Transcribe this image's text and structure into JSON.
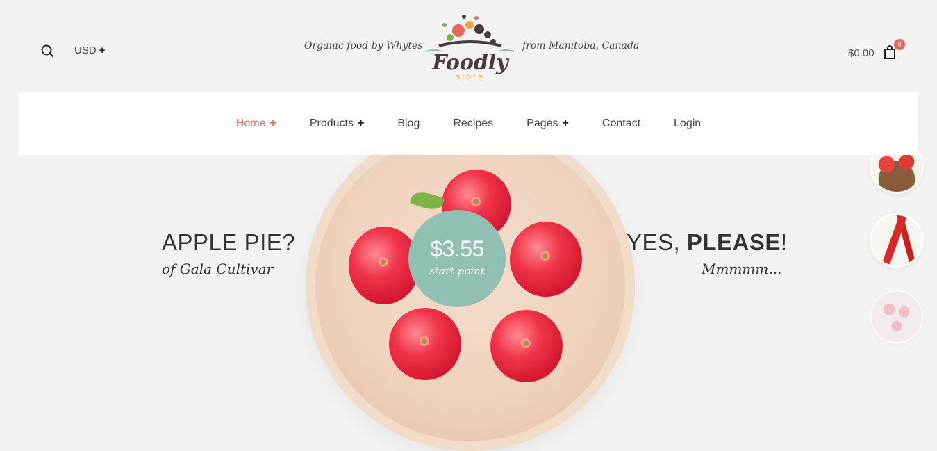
{
  "header": {
    "currency": "USD",
    "tagline_left": "Organic food by Whytes'",
    "tagline_right": "from Manitoba, Canada",
    "logo_text": "Foodly",
    "logo_sub": "store",
    "cart_total": "$0.00",
    "cart_count": "0"
  },
  "nav": {
    "items": [
      {
        "label": "Home",
        "has_submenu": true
      },
      {
        "label": "Products",
        "has_submenu": true
      },
      {
        "label": "Blog",
        "has_submenu": false
      },
      {
        "label": "Recipes",
        "has_submenu": false
      },
      {
        "label": "Pages",
        "has_submenu": true
      },
      {
        "label": "Contact",
        "has_submenu": false
      },
      {
        "label": "Login",
        "has_submenu": false
      }
    ]
  },
  "hero": {
    "headline_left": "APPLE PIE?",
    "sub_left": "of Gala Cultivar",
    "headline_right_prefix": "YES, ",
    "headline_right_bold": "PLEASE",
    "headline_right_suffix": "!",
    "sub_right": "Mmmmm...",
    "price": "$3.55",
    "price_sub": "start point"
  },
  "colors": {
    "accent": "#e9655b",
    "price_circle": "#8fc0b3",
    "background": "#f3f3f4"
  },
  "icons": {
    "search": "search-icon",
    "cart": "shopping-bag-icon",
    "plus": "plus-icon"
  }
}
